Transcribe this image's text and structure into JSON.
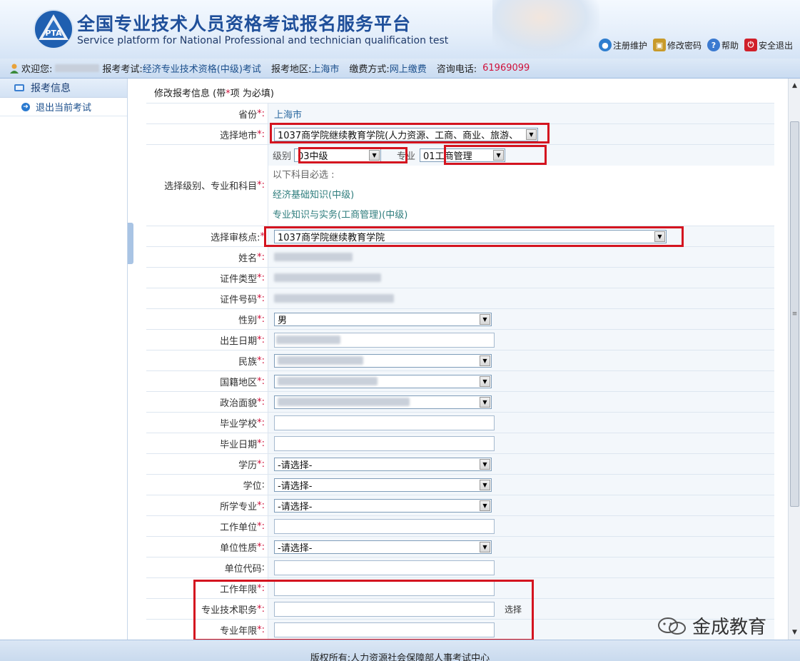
{
  "header": {
    "title": "全国专业技术人员资格考试报名服务平台",
    "subtitle": "Service platform for National Professional and technician qualification test",
    "links": [
      {
        "label": "注册维护",
        "icon": "globe-icon",
        "color": "#2f7ecf"
      },
      {
        "label": "修改密码",
        "icon": "lock-icon",
        "color": "#c89a2a"
      },
      {
        "label": "帮助",
        "icon": "help-icon",
        "color": "#3b7ad0"
      },
      {
        "label": "安全退出",
        "icon": "power-icon",
        "color": "#d0202a"
      }
    ]
  },
  "infobar": {
    "welcome": "欢迎您:",
    "exam_label": "报考考试:",
    "exam_value": "经济专业技术资格(中级)考试",
    "region_label": "报考地区:",
    "region_value": "上海市",
    "payment_label": "缴费方式:",
    "payment_value": "网上缴费",
    "phone_label": "咨询电话:",
    "phone_value": "61969099"
  },
  "sidebar": {
    "header": "报考信息",
    "items": [
      {
        "label": "退出当前考试"
      }
    ]
  },
  "form": {
    "title_pre": "修改报考信息 (带",
    "title_star": "*",
    "title_post": "项 为必填)",
    "province": {
      "label": "省份",
      "value": "上海市"
    },
    "city": {
      "label": "选择地市",
      "value": "1037商学院继续教育学院(人力资源、工商、商业、旅游、"
    },
    "level_major": {
      "label": "选择级别、专业和科目",
      "level_label": "级别",
      "level_value": "03中级",
      "major_label": "专业",
      "major_value": "01工商管理",
      "required_note": "以下科目必选 :",
      "subjects": [
        "经济基础知识(中级)",
        "专业知识与实务(工商管理)(中级)"
      ]
    },
    "review_point": {
      "label": "选择审核点:",
      "value": "1037商学院继续教育学院"
    },
    "name": {
      "label": "姓名"
    },
    "id_type": {
      "label": "证件类型"
    },
    "id_number": {
      "label": "证件号码"
    },
    "gender": {
      "label": "性别",
      "value": "男"
    },
    "birth_date": {
      "label": "出生日期"
    },
    "ethnicity": {
      "label": "民族"
    },
    "nationality": {
      "label": "国籍地区"
    },
    "political": {
      "label": "政治面貌"
    },
    "school": {
      "label": "毕业学校"
    },
    "grad_date": {
      "label": "毕业日期"
    },
    "education": {
      "label": "学历",
      "value": "-请选择-"
    },
    "degree": {
      "label": "学位",
      "value": "-请选择-"
    },
    "major_studied": {
      "label": "所学专业",
      "value": "-请选择-"
    },
    "employer": {
      "label": "工作单位"
    },
    "employer_type": {
      "label": "单位性质",
      "value": "-请选择-"
    },
    "employer_code": {
      "label": "单位代码"
    },
    "work_years": {
      "label": "工作年限"
    },
    "tech_position": {
      "label": "专业技术职务",
      "button": "选择"
    },
    "pro_years": {
      "label": "专业年限"
    }
  },
  "footer": {
    "text": "版权所有:人力资源社会保障部人事考试中心"
  },
  "watermark": {
    "text": "金成教育"
  },
  "colors": {
    "accent": "#1f4f9a",
    "required": "#d0103a",
    "highlight_box": "#d4141f"
  }
}
